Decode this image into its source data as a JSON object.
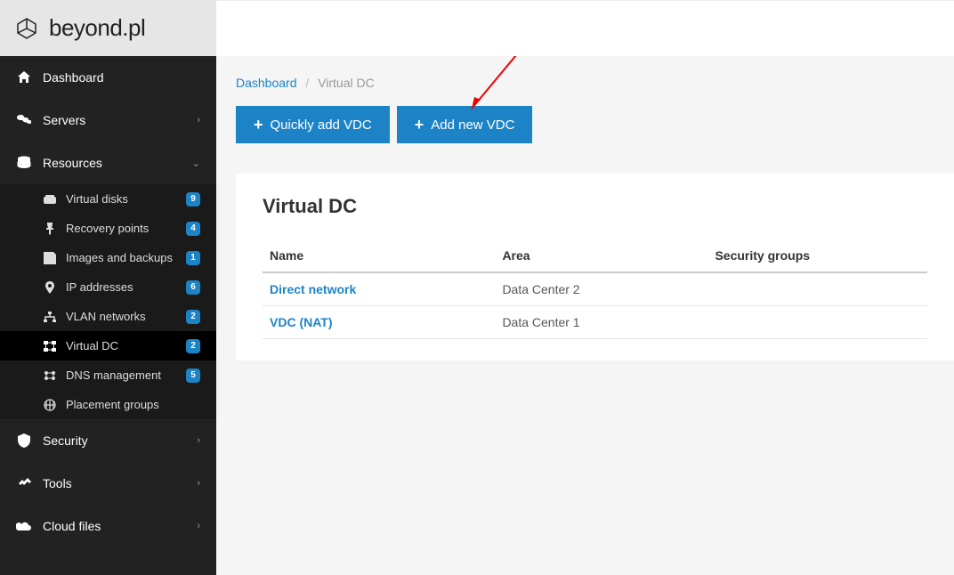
{
  "logo_text": "beyond.pl",
  "sidebar": {
    "items": [
      {
        "label": "Dashboard",
        "expand": null
      },
      {
        "label": "Servers",
        "expand": "right"
      },
      {
        "label": "Resources",
        "expand": "down"
      },
      {
        "label": "Security",
        "expand": "right"
      },
      {
        "label": "Tools",
        "expand": "right"
      },
      {
        "label": "Cloud files",
        "expand": "right"
      }
    ],
    "resources_sub": [
      {
        "label": "Virtual disks",
        "badge": "9"
      },
      {
        "label": "Recovery points",
        "badge": "4"
      },
      {
        "label": "Images and backups",
        "badge": "1"
      },
      {
        "label": "IP addresses",
        "badge": "6"
      },
      {
        "label": "VLAN networks",
        "badge": "2"
      },
      {
        "label": "Virtual DC",
        "badge": "2"
      },
      {
        "label": "DNS management",
        "badge": "5"
      },
      {
        "label": "Placement groups",
        "badge": ""
      }
    ]
  },
  "breadcrumb": {
    "root": "Dashboard",
    "current": "Virtual DC"
  },
  "buttons": {
    "quick_add": "Quickly add VDC",
    "add_new": "Add new VDC"
  },
  "card": {
    "title": "Virtual DC",
    "columns": {
      "c1": "Name",
      "c2": "Area",
      "c3": "Security groups"
    },
    "rows": [
      {
        "name": "Direct network",
        "area": "Data Center 2",
        "sg": ""
      },
      {
        "name": "VDC (NAT)",
        "area": "Data Center 1",
        "sg": ""
      }
    ]
  }
}
